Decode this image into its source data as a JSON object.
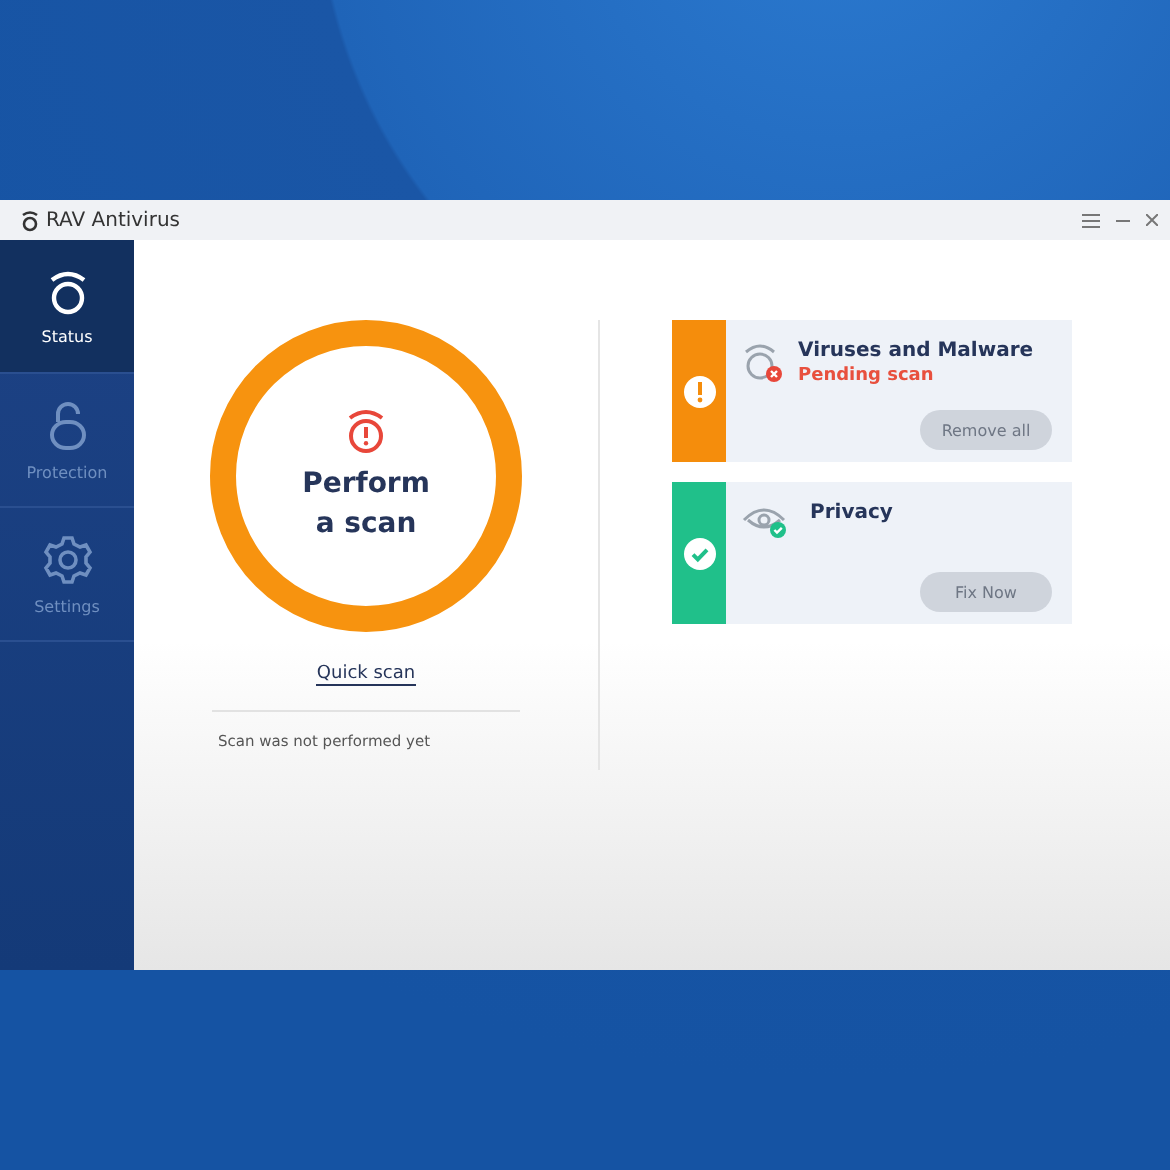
{
  "window": {
    "title": "RAV Antivirus"
  },
  "sidebar": {
    "items": [
      {
        "kind": "status",
        "label": "Status",
        "selected": true
      },
      {
        "kind": "protection",
        "label": "Protection",
        "selected": false
      },
      {
        "kind": "settings",
        "label": "Settings",
        "selected": false
      }
    ]
  },
  "scan": {
    "heading": "Perform a scan",
    "link": "Quick scan",
    "note": "Scan was not performed yet"
  },
  "cards": [
    {
      "kind": "warning",
      "color": "#f58d0c",
      "title": "Viruses and Malware",
      "subtitle": "Pending scan",
      "button": "Remove all",
      "disabled": true
    },
    {
      "kind": "ok",
      "color": "#20c08a",
      "title": "Privacy",
      "button": "Fix Now",
      "disabled": true
    }
  ]
}
